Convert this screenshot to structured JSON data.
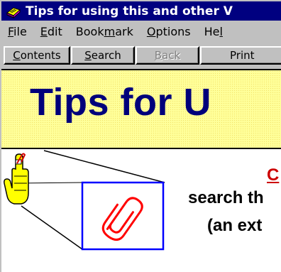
{
  "window": {
    "title": "Tips for using this and other V",
    "app_icon": "help-book-icon"
  },
  "menu": [
    {
      "id": "file",
      "hot": "F",
      "rest": "ile"
    },
    {
      "id": "edit",
      "hot": "E",
      "rest": "dit"
    },
    {
      "id": "bookmark",
      "pre": "Book",
      "hot": "m",
      "rest": "ark"
    },
    {
      "id": "options",
      "hot": "O",
      "rest": "ptions"
    },
    {
      "id": "help",
      "pre": "He",
      "hot": "l",
      "rest": ""
    }
  ],
  "toolbar": {
    "contents": {
      "hot": "C",
      "rest": "ontents"
    },
    "search": {
      "hot": "S",
      "rest": "earch"
    },
    "back": {
      "hot": "B",
      "rest": "ack",
      "enabled": false
    },
    "print": {
      "pre": "Print",
      "hot": "",
      "rest": ""
    }
  },
  "content": {
    "heading": "Tips for U",
    "link_text": "C",
    "body_line_1": "search th",
    "body_line_2": "(an ext",
    "icons": [
      "pointing-hand-icon",
      "paperclip-icon"
    ],
    "colors": {
      "banner_bg": "#ffff9a",
      "heading": "#00007b",
      "link": "#cc0000",
      "frame": "#0000ff"
    }
  }
}
